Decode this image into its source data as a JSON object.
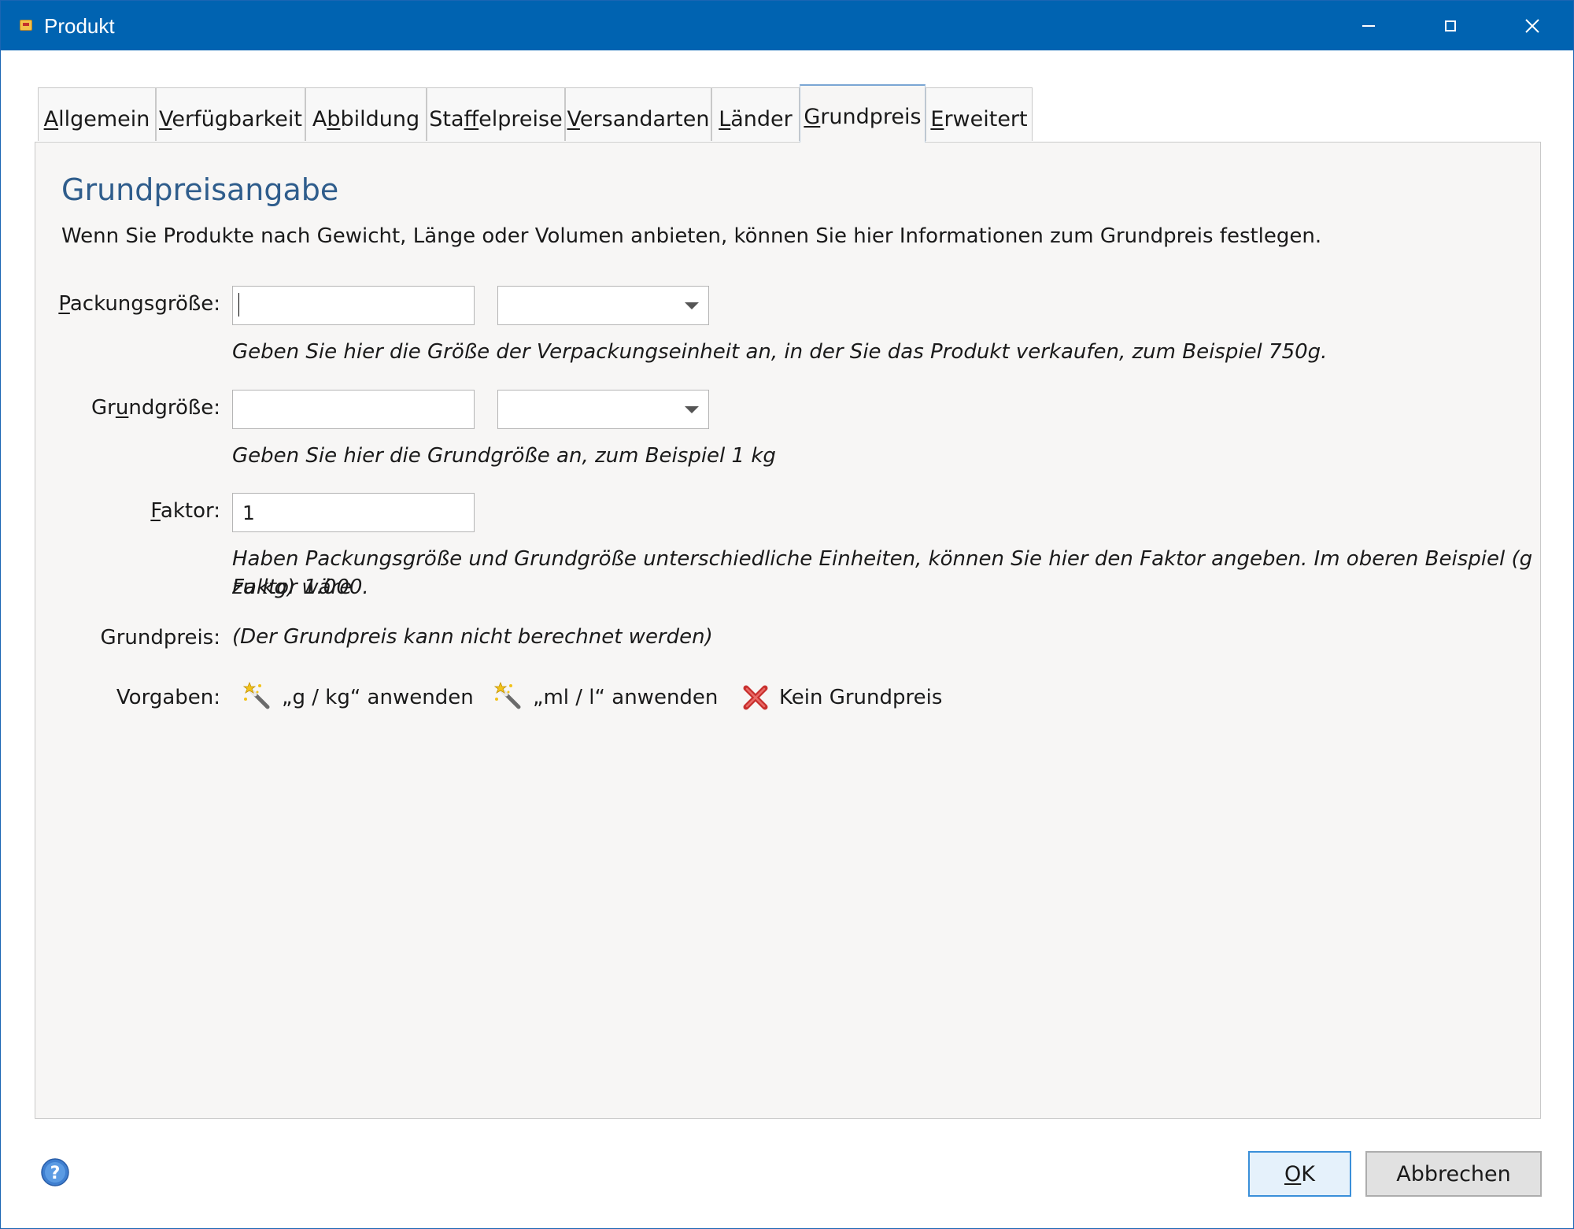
{
  "window": {
    "title": "Produkt",
    "icon": "product-app-icon",
    "controls": [
      "minimize-icon",
      "maximize-icon",
      "close-icon"
    ]
  },
  "tabs": [
    {
      "mnemonic": "A",
      "rest": "llgemein",
      "active": false
    },
    {
      "mnemonic": "V",
      "rest": "erfügbarkeit",
      "active": false
    },
    {
      "pre": "A",
      "mnemonic": "b",
      "rest": "bildung",
      "active": false
    },
    {
      "pre": "Sta",
      "mnemonic": "f",
      "rest": "felpreise",
      "active": false
    },
    {
      "mnemonic": "V",
      "rest": "ersandarten",
      "active": false
    },
    {
      "mnemonic": "L",
      "rest": "änder",
      "active": false
    },
    {
      "mnemonic": "G",
      "rest": "rundpreis",
      "active": true
    },
    {
      "mnemonic": "E",
      "rest": "rweitert",
      "active": false
    }
  ],
  "section": {
    "heading": "Grundpreisangabe",
    "intro": "Wenn Sie Produkte nach Gewicht, Länge oder Volumen anbieten, können Sie hier Informationen zum Grundpreis festlegen."
  },
  "fields": {
    "packungsgroesse": {
      "label_mnemonic": "P",
      "label_rest": "ackungsgröße:",
      "value": "",
      "unit_value": "",
      "hint": "Geben Sie hier die Größe der Verpackungseinheit an, in der Sie das Produkt verkaufen, zum Beispiel 750g."
    },
    "grundgroesse": {
      "label_pre": "Gr",
      "label_mnemonic": "u",
      "label_rest": "ndgröße:",
      "value": "",
      "unit_value": "",
      "hint": "Geben Sie hier die Grundgröße an, zum Beispiel 1 kg"
    },
    "faktor": {
      "label_mnemonic": "F",
      "label_rest": "aktor:",
      "value": "1",
      "hint_line1": "Haben Packungsgröße und Grundgröße unterschiedliche Einheiten, können Sie hier den Faktor angeben. Im oberen Beispiel (g zu kg) wäre",
      "hint_line2": "Faktor 1.000."
    },
    "grundpreis": {
      "label": "Grundpreis:",
      "value": "(Der Grundpreis kann nicht berechnet werden)"
    }
  },
  "presets": {
    "label": "Vorgaben:",
    "items": [
      {
        "label": "„g / kg“ anwenden",
        "icon": "magic-wand-icon"
      },
      {
        "label": "„ml / l“ anwenden",
        "icon": "magic-wand-icon"
      },
      {
        "label": "Kein Grundpreis",
        "icon": "red-x-icon"
      }
    ]
  },
  "footer": {
    "help_icon": "help-icon",
    "ok_mnemonic": "O",
    "ok_rest": "K",
    "cancel_label": "Abbrechen"
  }
}
